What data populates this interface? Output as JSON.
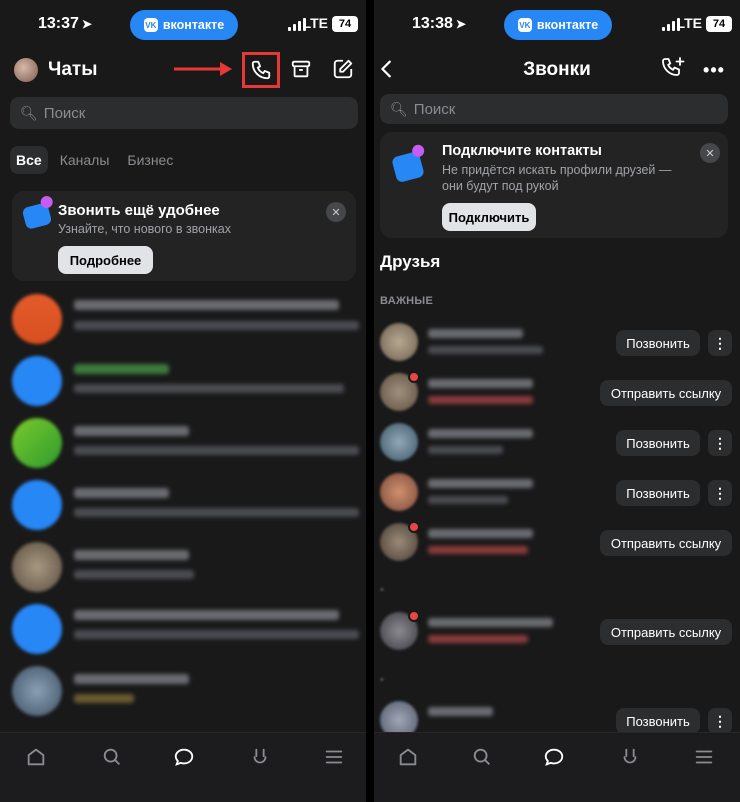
{
  "left": {
    "status": {
      "time": "13:37",
      "vk_label": "вконтакте",
      "network": "LTE",
      "battery": "74"
    },
    "header": {
      "title": "Чаты"
    },
    "search": {
      "placeholder": "Поиск"
    },
    "tabs": [
      {
        "label": "Все",
        "active": true
      },
      {
        "label": "Каналы",
        "active": false
      },
      {
        "label": "Бизнес",
        "active": false
      }
    ],
    "promo": {
      "title": "Звонить ещё удобнее",
      "subtitle": "Узнайте, что нового в звонках",
      "button": "Подробнее"
    }
  },
  "right": {
    "status": {
      "time": "13:38",
      "vk_label": "вконтакте",
      "network": "LTE",
      "battery": "74"
    },
    "header": {
      "title": "Звонки"
    },
    "search": {
      "placeholder": "Поиск"
    },
    "promo": {
      "title": "Подключите контакты",
      "subtitle_line1": "Не придётся искать профили друзей —",
      "subtitle_line2": "они будут под рукой",
      "button": "Подключить"
    },
    "friends_title": "Друзья",
    "important_label": "ВАЖНЫЕ",
    "friends": [
      {
        "action": "Позвонить"
      },
      {
        "action": "Отправить ссылку"
      },
      {
        "action": "Позвонить"
      },
      {
        "action": "Позвонить"
      },
      {
        "action": "Отправить ссылку"
      },
      {
        "action": "Отправить ссылку"
      },
      {
        "action": "Позвонить"
      }
    ]
  },
  "colors": {
    "accent": "#2787f5",
    "annotation": "#e53935",
    "background": "#19191a"
  },
  "icons": [
    "navigation-arrow-icon",
    "phone-icon",
    "archive-icon",
    "compose-icon",
    "back-icon",
    "add-call-icon",
    "more-icon",
    "search-icon",
    "home-icon",
    "messages-icon",
    "services-icon",
    "menu-icon"
  ]
}
